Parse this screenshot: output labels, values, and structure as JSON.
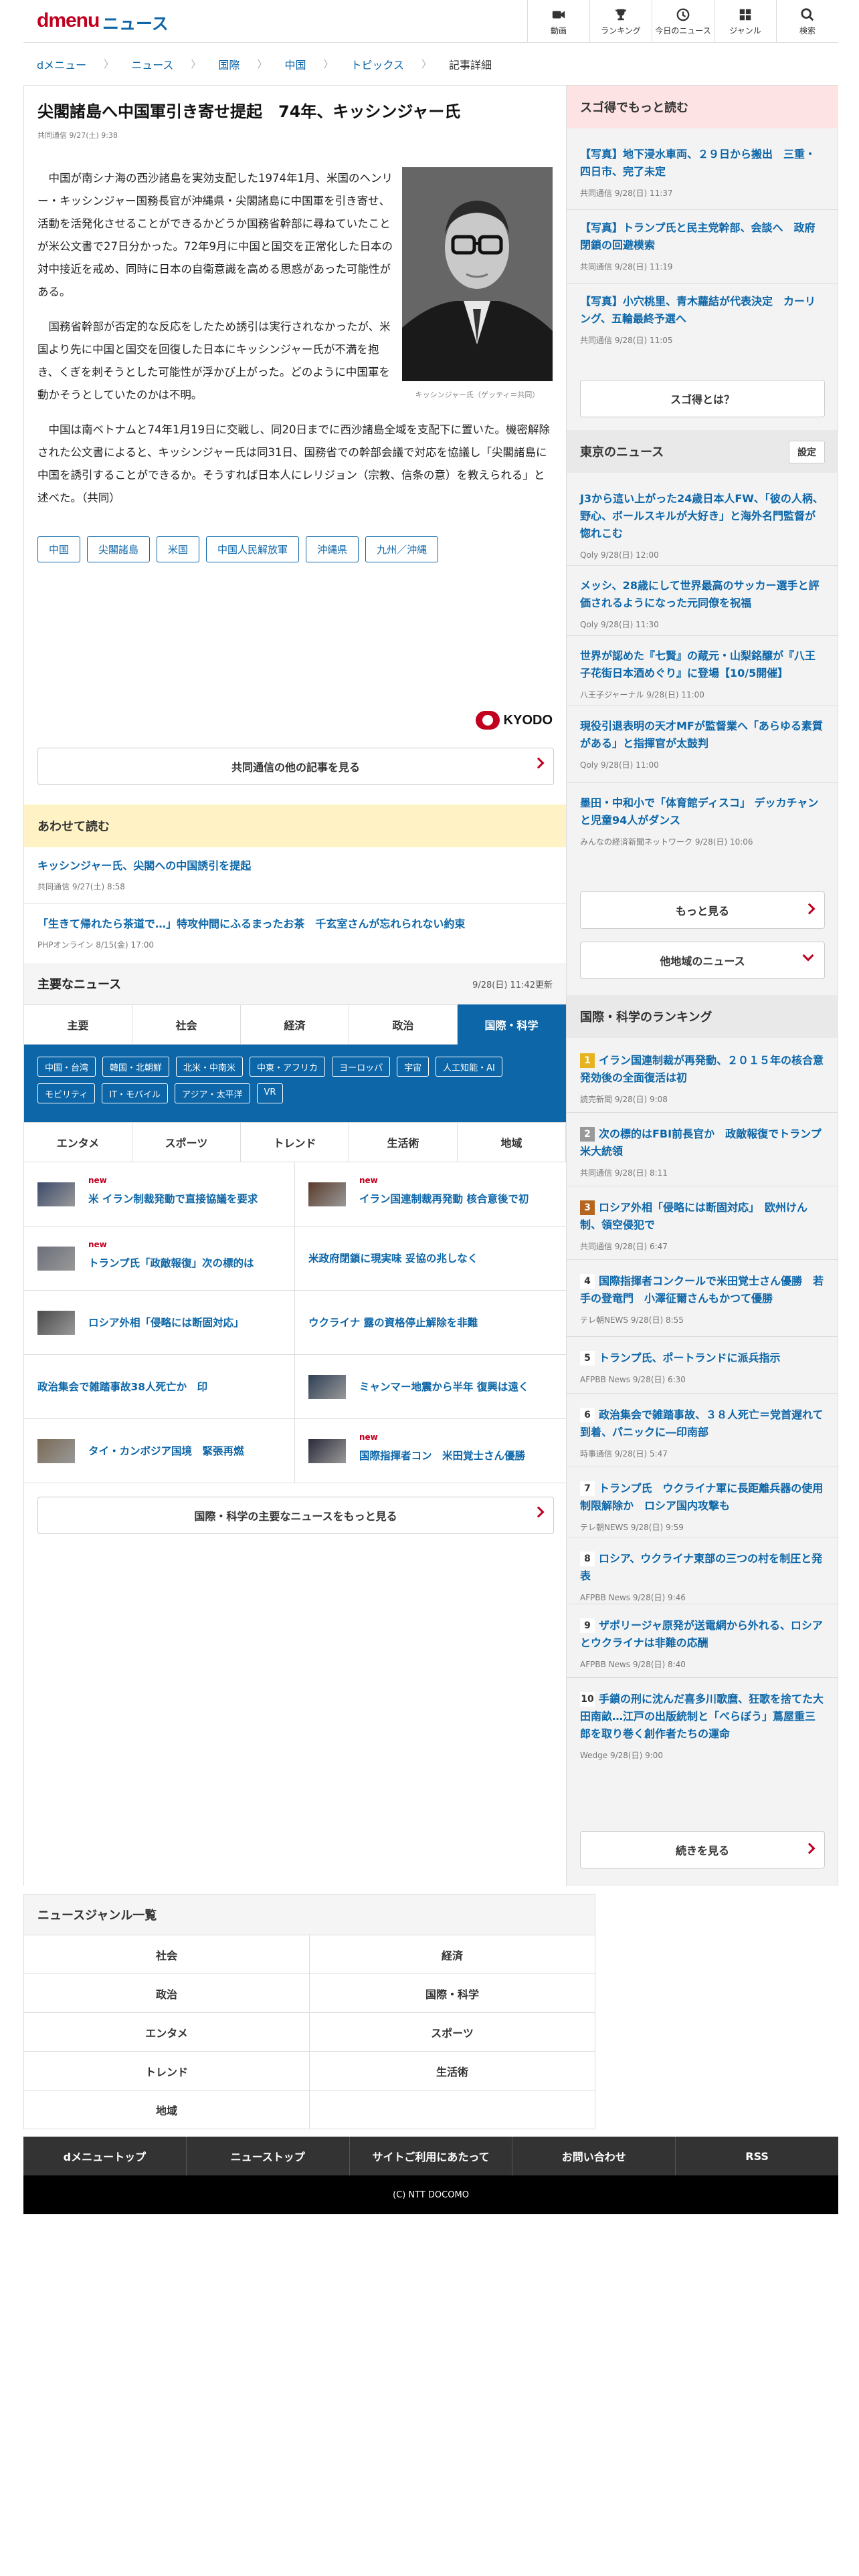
{
  "header": {
    "logo": "dmenu",
    "section": "ニュース",
    "nav": [
      {
        "icon": "video-icon",
        "label": "動画"
      },
      {
        "icon": "trophy-icon",
        "label": "ランキング"
      },
      {
        "icon": "clock-icon",
        "label": "今日のニュース"
      },
      {
        "icon": "genre-grid-icon",
        "label": "ジャンル"
      },
      {
        "icon": "search-icon",
        "label": "検索"
      }
    ]
  },
  "breadcrumb": [
    "dメニュー",
    "ニュース",
    "国際",
    "中国",
    "トピックス",
    "記事詳細"
  ],
  "article": {
    "title": "尖閣諸島へ中国軍引き寄せ提起　74年、キッシンジャー氏",
    "meta": "共同通信 9/27(土) 9:38",
    "paragraphs": [
      "中国が南シナ海の西沙諸島を実効支配した1974年1月、米国のヘンリー・キッシンジャー国務長官が沖縄県・尖閣諸島に中国軍を引き寄せ、活動を活発化させることができるかどうか国務省幹部に尋ねていたことが米公文書で27日分かった。72年9月に中国と国交を正常化した日本の対中接近を戒め、同時に日本の自衛意識を高める思惑があった可能性がある。",
      "国務省幹部が否定的な反応をしたため誘引は実行されなかったが、米国より先に中国と国交を回復した日本にキッシンジャー氏が不満を抱き、くぎを刺そうとした可能性が浮かび上がった。どのように中国軍を動かそうとしていたのかは不明。",
      "中国は南ベトナムと74年1月19日に交戦し、同20日までに西沙諸島全域を支配下に置いた。機密解除された公文書によると、キッシンジャー氏は同31日、国務省での幹部会議で対応を協議し「尖閣諸島に中国を誘引することができるか。そうすれば日本人にレリジョン（宗教、信条の意）を教えられる」と述べた。（共同）"
    ],
    "photo_caption": "キッシンジャー氏（ゲッティ＝共同）",
    "tags": [
      "中国",
      "尖閣諸島",
      "米国",
      "中国人民解放軍",
      "沖縄県",
      "九州／沖縄"
    ],
    "source_logo": "KYODO",
    "more_button": "共同通信の他の記事を見る"
  },
  "related": {
    "title": "あわせて読む",
    "items": [
      {
        "title": "キッシンジャー氏、尖閣への中国誘引を提起",
        "meta": "共同通信 9/27(土) 8:58"
      },
      {
        "title": "「生きて帰れたら茶道で…」特攻仲間にふるまったお茶　千玄室さんが忘れられない約束",
        "meta": "PHPオンライン 8/15(金) 17:00"
      }
    ]
  },
  "major_news": {
    "title": "主要なニュース",
    "updated": "9/28(日) 11:42更新",
    "tabs_row1": [
      "主要",
      "社会",
      "経済",
      "政治",
      "国際・科学"
    ],
    "active_tab": "国際・科学",
    "subtags": [
      "中国・台湾",
      "韓国・北朝鮮",
      "北米・中南米",
      "中東・アフリカ",
      "ヨーロッパ",
      "宇宙",
      "人工知能・AI",
      "モビリティ",
      "IT・モバイル",
      "アジア・太平洋",
      "VR"
    ],
    "tabs_row2": [
      "エンタメ",
      "スポーツ",
      "トレンド",
      "生活術",
      "地域"
    ],
    "new_label": "new",
    "items": [
      {
        "title": "米 イラン制裁発動で直接協議を要求",
        "thumb": true,
        "new": true
      },
      {
        "title": "イラン国連制裁再発動 核合意後で初",
        "thumb": true,
        "new": true
      },
      {
        "title": "トランプ氏「政敵報復」次の標的は",
        "thumb": true,
        "new": true
      },
      {
        "title": "米政府閉鎖に現実味 妥協の兆しなく",
        "thumb": false,
        "new": false
      },
      {
        "title": "ロシア外相「侵略には断固対応」",
        "thumb": true,
        "new": false
      },
      {
        "title": "ウクライナ 露の資格停止解除を非難",
        "thumb": false,
        "new": false
      },
      {
        "title": "政治集会で雑踏事故38人死亡か　印",
        "thumb": false,
        "new": false
      },
      {
        "title": "ミャンマー地震から半年 復興は遠く",
        "thumb": true,
        "new": false
      },
      {
        "title": "タイ・カンボジア国境　緊張再燃",
        "thumb": true,
        "new": false
      },
      {
        "title": "国際指揮者コン　米田覚士さん優勝",
        "thumb": true,
        "new": true
      }
    ],
    "more_button": "国際・科学の主要なニュースをもっと見る"
  },
  "genre_list": {
    "title": "ニュースジャンル一覧",
    "rows": [
      [
        "社会",
        "経済"
      ],
      [
        "政治",
        "国際・科学"
      ],
      [
        "エンタメ",
        "スポーツ"
      ],
      [
        "トレンド",
        "生活術"
      ],
      [
        "地域",
        ""
      ]
    ]
  },
  "footer": {
    "nav": [
      "dメニュートップ",
      "ニューストップ",
      "サイトご利用にあたって",
      "お問い合わせ",
      "RSS"
    ],
    "copyright": "(C) NTT DOCOMO"
  },
  "sidebar": {
    "sugotoku": {
      "title": "スゴ得でもっと読む",
      "items": [
        {
          "title": "【写真】地下浸水車両、２９日から搬出　三重・四日市、完了未定",
          "meta": "共同通信 9/28(日) 11:37"
        },
        {
          "title": "【写真】トランプ氏と民主党幹部、会談へ　政府閉鎖の回避模索",
          "meta": "共同通信 9/28(日) 11:19"
        },
        {
          "title": "【写真】小穴桃里、青木蘿結が代表決定　カーリング、五輪最終予選へ",
          "meta": "共同通信 9/28(日) 11:05"
        }
      ],
      "button": "スゴ得とは？"
    },
    "tokyo": {
      "title": "東京のニュース",
      "settings": "設定",
      "items": [
        {
          "title": "J3から這い上がった24歳日本人FW、「彼の人柄、野心、ボールスキルが大好き」と海外名門監督が惚れこむ",
          "meta": "Qoly 9/28(日) 12:00"
        },
        {
          "title": "メッシ、28歳にして世界最高のサッカー選手と評価されるようになった元同僚を祝福",
          "meta": "Qoly 9/28(日) 11:30"
        },
        {
          "title": "世界が認めた『七賢』の蔵元・山梨銘醸が『八王子花街日本酒めぐり』に登場【10/5開催】",
          "meta": "八王子ジャーナル 9/28(日) 11:00"
        },
        {
          "title": "現役引退表明の天才MFが監督業へ「あらゆる素質がある」と指揮官が太鼓判",
          "meta": "Qoly 9/28(日) 11:00"
        },
        {
          "title": "墨田・中和小で「体育館ディスコ」 デッカチャンと児童94人がダンス",
          "meta": "みんなの経済新聞ネットワーク 9/28(日) 10:06"
        }
      ],
      "more_button": "もっと見る",
      "other_button": "他地域のニュース"
    },
    "ranking": {
      "title": "国際・科学のランキング",
      "items": [
        {
          "rank": "1",
          "title": "イラン国連制裁が再発動、２０１５年の核合意発効後の全面復活は初",
          "meta": "読売新聞 9/28(日) 9:08"
        },
        {
          "rank": "2",
          "title": "次の標的はFBI前長官か　政敵報復でトランプ米大統領",
          "meta": "共同通信 9/28(日) 8:11"
        },
        {
          "rank": "3",
          "title": "ロシア外相「侵略には断固対応」　欧州けん制、領空侵犯で",
          "meta": "共同通信 9/28(日) 6:47"
        },
        {
          "rank": "4",
          "title": "国際指揮者コンクールで米田覚士さん優勝　若手の登竜門　小澤征爾さんもかつて優勝",
          "meta": "テレ朝NEWS 9/28(日) 8:55"
        },
        {
          "rank": "5",
          "title": "トランプ氏、ポートランドに派兵指示",
          "meta": "AFPBB News 9/28(日) 6:30"
        },
        {
          "rank": "6",
          "title": "政治集会で雑踏事故、３８人死亡＝党首遅れて到着、パニックに―印南部",
          "meta": "時事通信 9/28(日) 5:47"
        },
        {
          "rank": "7",
          "title": "トランプ氏　ウクライナ軍に長距離兵器の使用制限解除か　ロシア国内攻撃も",
          "meta": "テレ朝NEWS 9/28(日) 9:59"
        },
        {
          "rank": "8",
          "title": "ロシア、ウクライナ東部の三つの村を制圧と発表",
          "meta": "AFPBB News 9/28(日) 9:46"
        },
        {
          "rank": "9",
          "title": "ザポリージャ原発が送電網から外れる、ロシアとウクライナは非難の応酬",
          "meta": "AFPBB News 9/28(日) 8:40"
        },
        {
          "rank": "10",
          "title": "手鎖の刑に沈んだ喜多川歌麿、狂歌を捨てた大田南畝…江戸の出版統制と「べらぼう」蔦屋重三郎を取り巻く創作者たちの運命",
          "meta": "Wedge 9/28(日) 9:00"
        }
      ],
      "button": "続きを見る"
    },
    "colors": {
      "rank1": "#e6b422",
      "rank2": "#999999",
      "rank3": "#b5651d",
      "rank_other": "#ffffff"
    }
  }
}
